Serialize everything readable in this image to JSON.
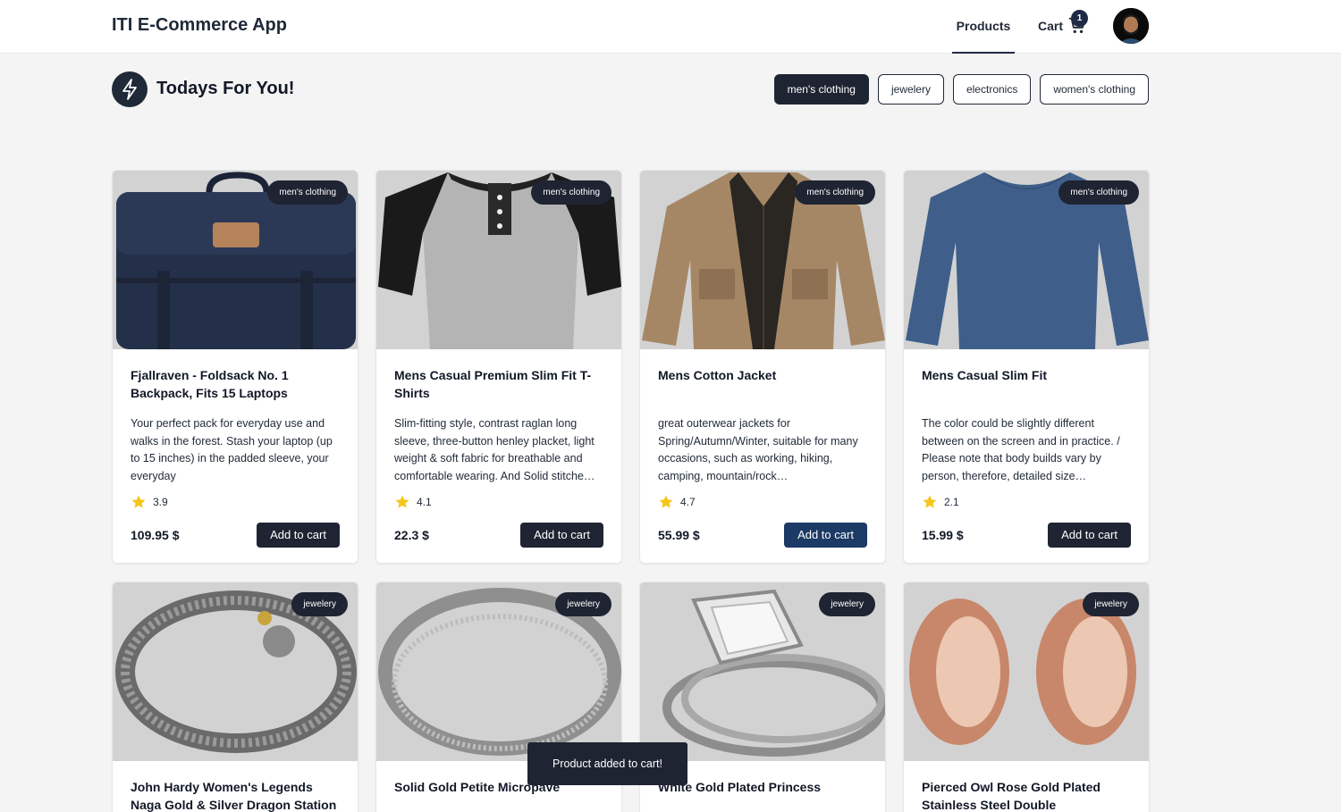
{
  "app": {
    "brand": "ITI E-Commerce App"
  },
  "nav": {
    "products_label": "Products",
    "cart_label": "Cart",
    "cart_count": "1"
  },
  "section": {
    "title": "Todays For You!"
  },
  "filters": [
    "men's clothing",
    "jewelery",
    "electronics",
    "women's clothing"
  ],
  "active_filter": "men's clothing",
  "products": [
    {
      "category": "men's clothing",
      "title": "Fjallraven - Foldsack No. 1 Backpack, Fits 15 Laptops",
      "description": "Your perfect pack for everyday use and walks in the forest. Stash your laptop (up to 15 inches) in the padded sleeve, your everyday",
      "rating": "3.9",
      "price": "109.95 $",
      "button": "Add to cart",
      "image": "backpack"
    },
    {
      "category": "men's clothing",
      "title": "Mens Casual Premium Slim Fit T-Shirts",
      "description": "Slim-fitting style, contrast raglan long sleeve, three-button henley placket, light weight & soft fabric for breathable and comfortable wearing. And Solid stitche…",
      "rating": "4.1",
      "price": "22.3 $",
      "button": "Add to cart",
      "image": "henley-shirt"
    },
    {
      "category": "men's clothing",
      "title": "Mens Cotton Jacket",
      "description": "great outerwear jackets for Spring/Autumn/Winter, suitable for many occasions, such as working, hiking, camping, mountain/rock…",
      "rating": "4.7",
      "price": "55.99 $",
      "button": "Add to cart",
      "image": "cotton-jacket"
    },
    {
      "category": "men's clothing",
      "title": "Mens Casual Slim Fit",
      "description": "The color could be slightly different between on the screen and in practice. / Please note that body builds vary by person, therefore, detailed size…",
      "rating": "2.1",
      "price": "15.99 $",
      "button": "Add to cart",
      "image": "blue-longsleeve"
    },
    {
      "category": "jewelery",
      "title": "John Hardy Women's Legends Naga Gold & Silver Dragon Station Chain…",
      "image": "dragon-bracelet"
    },
    {
      "category": "jewelery",
      "title": "Solid Gold Petite Micropave",
      "image": "silver-ring"
    },
    {
      "category": "jewelery",
      "title": "White Gold Plated Princess",
      "image": "princess-ring"
    },
    {
      "category": "jewelery",
      "title": "Pierced Owl Rose Gold Plated Stainless Steel Double",
      "image": "rose-gold-plugs"
    }
  ],
  "toast": {
    "message": "Product added to cart!"
  },
  "colors": {
    "primary": "#1f2432",
    "hover_button": "#1c3a66",
    "background": "#f4f4f5",
    "star": "#f5c518"
  }
}
